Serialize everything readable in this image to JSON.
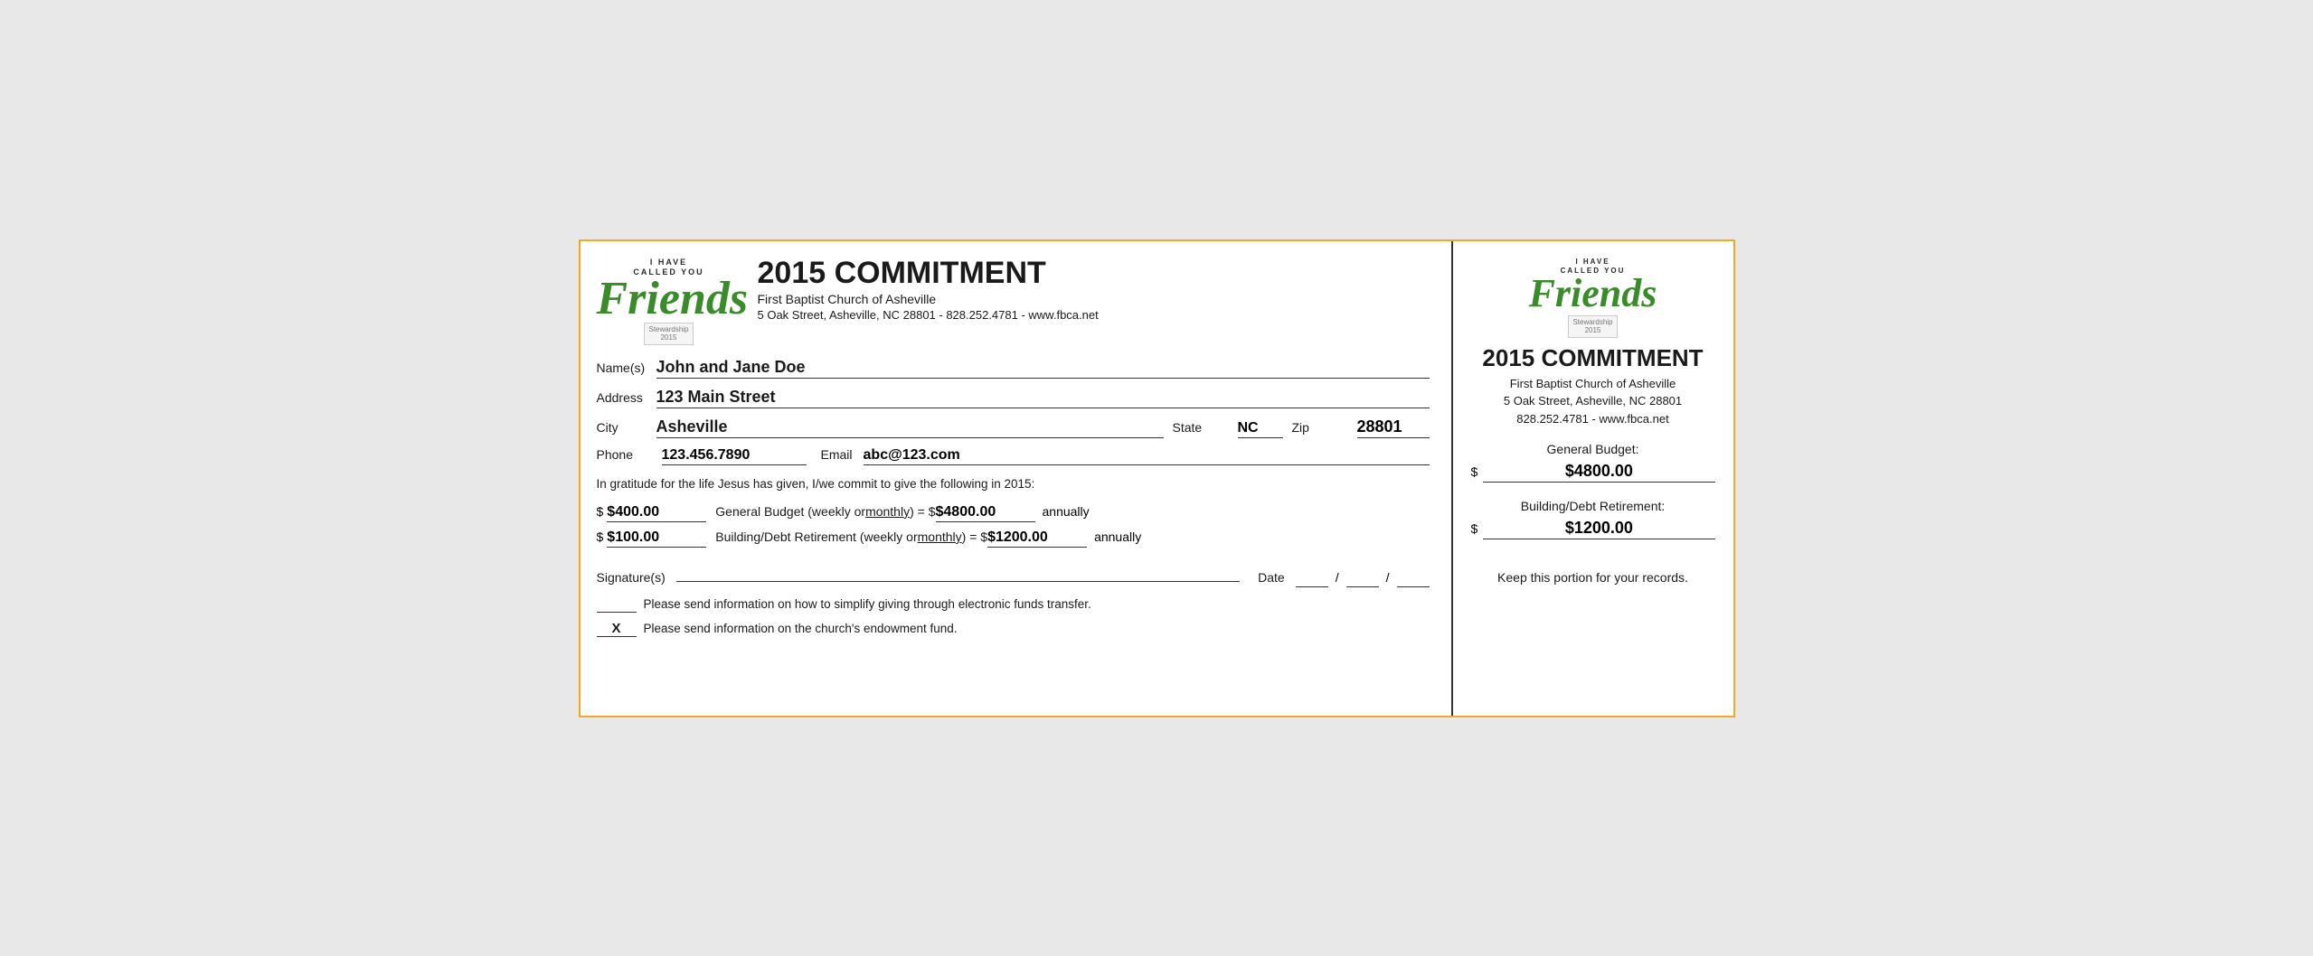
{
  "page": {
    "border_color": "#f5a623"
  },
  "left": {
    "logo": {
      "top_line1": "I HAVE",
      "top_line2": "CALLED YOU",
      "friends": "Friends",
      "stewardship": "Stewardship",
      "year": "2015"
    },
    "header": {
      "title": "2015 COMMITMENT",
      "church_name": "First Baptist Church of Asheville",
      "address": "5 Oak Street, Asheville, NC  28801 - 828.252.4781 - www.fbca.net"
    },
    "form": {
      "name_label": "Name(s)",
      "name_value": "John and Jane Doe",
      "address_label": "Address",
      "address_value": "123 Main Street",
      "city_label": "City",
      "city_value": "Asheville",
      "state_label": "State",
      "state_value": "NC",
      "zip_label": "Zip",
      "zip_value": "28801",
      "phone_label": "Phone",
      "phone_value": "123.456.7890",
      "email_label": "Email",
      "email_value": "abc@123.com"
    },
    "commitment_text": "In gratitude for the life Jesus has given, I/we commit to give the following in 2015:",
    "general_budget": {
      "dollar": "$",
      "amount": "$400.00",
      "desc_pre": "General Budget (weekly or ",
      "monthly": "monthly",
      "desc_post": ") = $",
      "annual": "$4800.00",
      "annually": "annually"
    },
    "building_debt": {
      "dollar": "$",
      "amount": "$100.00",
      "desc_pre": "Building/Debt Retirement (weekly or ",
      "monthly": "monthly",
      "desc_post": ") = $",
      "annual": "$1200.00",
      "annually": "annually"
    },
    "signature_label": "Signature(s)",
    "date_label": "Date",
    "checkbox1_text": "Please send information on how to simplify giving through electronic funds transfer.",
    "checkbox1_checked": false,
    "checkbox2_text": "Please send information on the church's endowment fund.",
    "checkbox2_checked": true,
    "checkbox2_mark": "X"
  },
  "right": {
    "logo": {
      "top_line1": "I HAVE",
      "top_line2": "CALLED YOU",
      "friends": "Friends",
      "stewardship": "Stewardship",
      "year": "2015"
    },
    "header": {
      "title": "2015 COMMITMENT",
      "church_name": "First Baptist Church of Asheville",
      "address_line1": "5 Oak Street, Asheville, NC  28801",
      "address_line2": "828.252.4781 - www.fbca.net"
    },
    "general_budget": {
      "label": "General Budget:",
      "dollar": "$",
      "amount": "$4800.00"
    },
    "building_debt": {
      "label": "Building/Debt Retirement:",
      "dollar": "$",
      "amount": "$1200.00"
    },
    "records_text": "Keep this portion for your records."
  }
}
